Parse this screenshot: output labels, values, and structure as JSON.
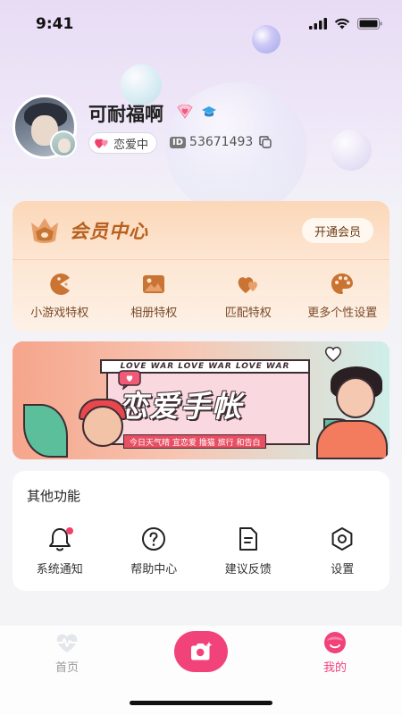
{
  "status_bar": {
    "time": "9:41"
  },
  "profile": {
    "username": "可耐福啊",
    "relationship_status": "恋爱中",
    "id_prefix": "ID",
    "user_id": "53671493"
  },
  "vip": {
    "title": "会员中心",
    "open_button": "开通会员",
    "items": [
      {
        "label": "小游戏特权",
        "icon": "pacman-icon"
      },
      {
        "label": "相册特权",
        "icon": "image-icon"
      },
      {
        "label": "匹配特权",
        "icon": "hearts-icon"
      },
      {
        "label": "更多个性设置",
        "icon": "palette-icon"
      }
    ]
  },
  "banner": {
    "ribbon": "LOVE WAR LOVE WAR LOVE WAR",
    "title": "恋爱手帐",
    "subtitle": "今日天气晴 宜恋爱 撸猫 旅行 和告白"
  },
  "functions": {
    "title": "其他功能",
    "items": [
      {
        "label": "系统通知",
        "icon": "bell-icon"
      },
      {
        "label": "帮助中心",
        "icon": "help-icon"
      },
      {
        "label": "建议反馈",
        "icon": "feedback-icon"
      },
      {
        "label": "设置",
        "icon": "settings-icon"
      }
    ]
  },
  "tabbar": {
    "home_label": "首页",
    "me_label": "我的",
    "active_tab": "我的"
  },
  "colors": {
    "accent": "#f2427a",
    "vip_text": "#b7601d",
    "vip_item_text": "#7a4a28"
  }
}
